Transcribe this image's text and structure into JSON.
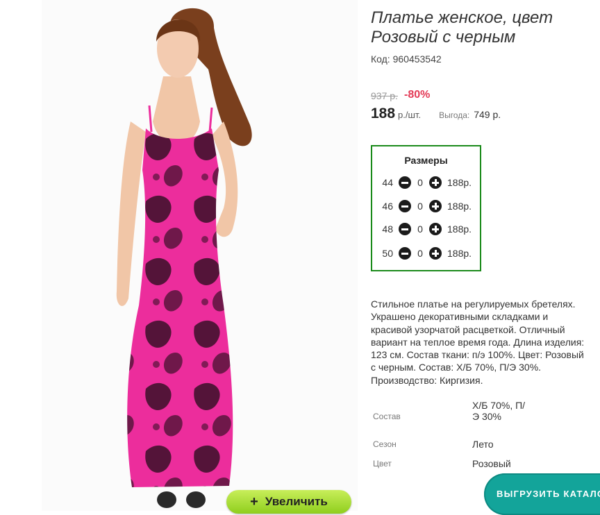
{
  "product": {
    "title": "Платье женское, цвет Розовый с черным",
    "code": "Код: 960453542",
    "old_price": "937 р.",
    "discount": "-80%",
    "price": "188",
    "unit": "р./шт.",
    "benefit_label": "Выгода:",
    "benefit_value": "749 р."
  },
  "sizes": {
    "title": "Размеры",
    "rows": [
      {
        "size": "44",
        "qty": "0",
        "price": "188р."
      },
      {
        "size": "46",
        "qty": "0",
        "price": "188р."
      },
      {
        "size": "48",
        "qty": "0",
        "price": "188р."
      },
      {
        "size": "50",
        "qty": "0",
        "price": "188р."
      }
    ]
  },
  "description": "Стильное платье на регулируемых бретелях. Украшено декоративными складками и красивой узорчатой расцветкой. Отличный вариант на теплое время года. Длина изделия: 123 см. Состав ткани: п/э 100%. Цвет: Розовый с черным. Состав: Х/Б 70%, П/Э 30%. Производство: Киргизия.",
  "attributes": [
    {
      "label": "Состав",
      "value": "Х/Б 70%, П/Э 30%"
    },
    {
      "label": "Сезон",
      "value": "Лето"
    },
    {
      "label": "Цвет",
      "value": "Розовый"
    }
  ],
  "buttons": {
    "zoom": "Увеличить",
    "export": "ВЫГРУЗИТЬ КАТАЛОГ"
  },
  "colors": {
    "discount": "#e33a56",
    "sizes_border": "#1a8a1a",
    "zoom_button": "#a5dc2e",
    "export_button": "#13a49a",
    "dress_pink": "#ec2d9c",
    "dress_pattern": "#3a0f28"
  },
  "icons": {
    "minus": "minus-circle-icon",
    "plus": "plus-circle-icon"
  }
}
